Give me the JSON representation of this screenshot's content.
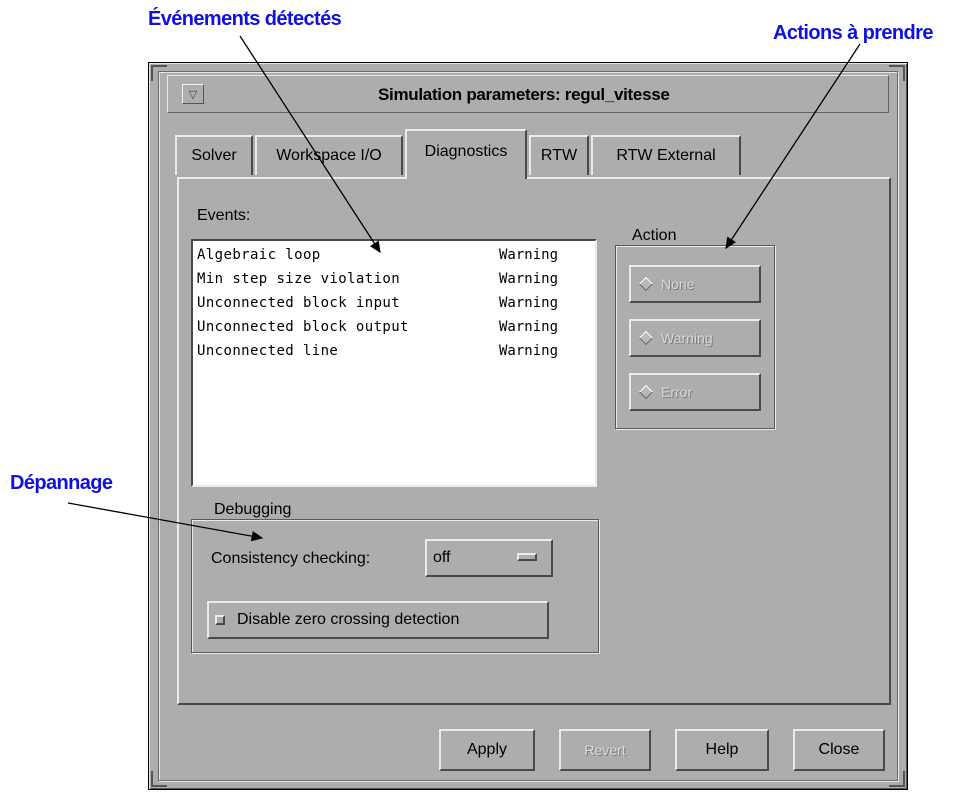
{
  "annotations": {
    "events_detected": "Événements détectés",
    "actions_to_take": "Actions à prendre",
    "debugging": "Dépannage"
  },
  "colors": {
    "annotation": "#1010e0",
    "window_bg": "#adadad",
    "list_bg": "#ffffff"
  },
  "window": {
    "title": "Simulation parameters: regul_vitesse",
    "menu_icon": "triangle-down-icon"
  },
  "tabs": [
    {
      "label": "Solver",
      "active": false
    },
    {
      "label": "Workspace I/O",
      "active": false
    },
    {
      "label": "Diagnostics",
      "active": true
    },
    {
      "label": "RTW",
      "active": false
    },
    {
      "label": "RTW External",
      "active": false
    }
  ],
  "events": {
    "label": "Events:",
    "items": [
      {
        "name": "Algebraic loop",
        "action": "Warning"
      },
      {
        "name": "Min step size violation",
        "action": "Warning"
      },
      {
        "name": "Unconnected block input",
        "action": "Warning"
      },
      {
        "name": "Unconnected block output",
        "action": "Warning"
      },
      {
        "name": "Unconnected line",
        "action": "Warning"
      }
    ]
  },
  "action": {
    "title": "Action",
    "options": [
      "None",
      "Warning",
      "Error"
    ]
  },
  "debugging": {
    "title": "Debugging",
    "consistency_label": "Consistency checking:",
    "consistency_value": "off",
    "zero_crossing_label": "Disable zero crossing detection"
  },
  "buttons": {
    "apply": "Apply",
    "revert": "Revert",
    "help": "Help",
    "close": "Close"
  }
}
